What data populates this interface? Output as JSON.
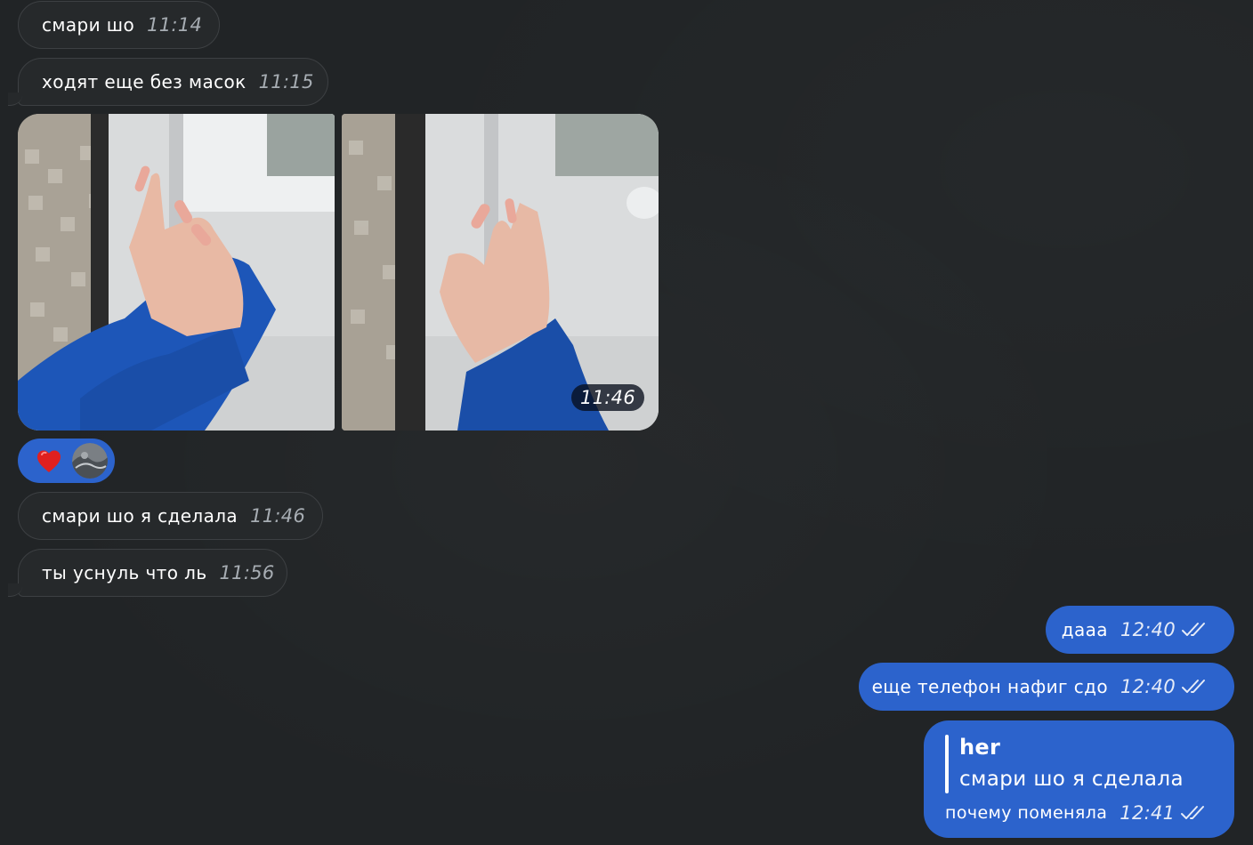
{
  "messages": [
    {
      "text": "смари шо",
      "time": "11:14"
    },
    {
      "text": "ходят еще без масок",
      "time": "11:15"
    },
    {
      "text": "смари шо я сделала",
      "time": "11:46"
    },
    {
      "text": "ты уснуль что ль",
      "time": "11:56"
    }
  ],
  "album": {
    "time": "11:46"
  },
  "reaction": {
    "emoji": "❤️",
    "icon": "heart-icon"
  },
  "sent": [
    {
      "text": "дааа",
      "time": "12:40"
    },
    {
      "text": "еще телефон нафиг сдо",
      "time": "12:40"
    }
  ],
  "reply": {
    "quote_author": "her",
    "quote_text": "смари шо я сделала",
    "text": "почему поменяла",
    "time": "12:41"
  },
  "colors": {
    "background": "#212426",
    "incoming_bubble": "#26292b",
    "outgoing_bubble": "#2c63cc"
  }
}
